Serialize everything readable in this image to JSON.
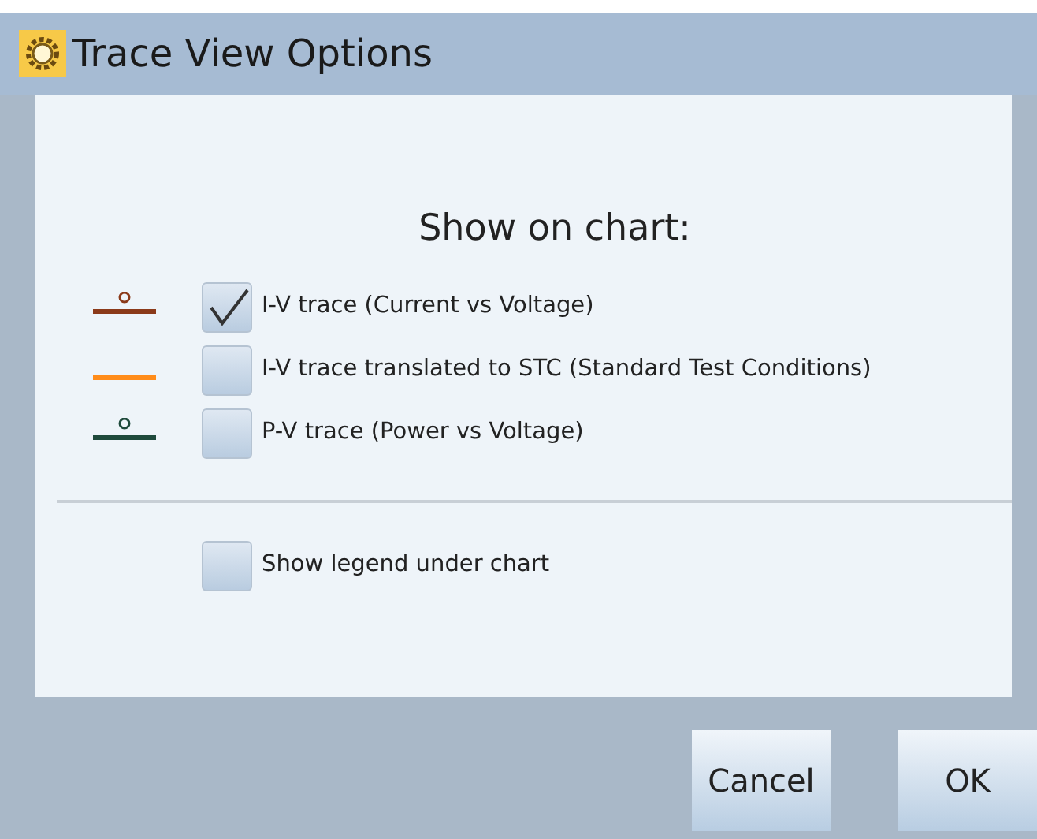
{
  "window": {
    "title": "Trace View Options"
  },
  "heading": "Show on chart:",
  "traces": [
    {
      "label": "I-V trace (Current vs Voltage)",
      "checked": true,
      "color": "#8b3a1a",
      "marker": true
    },
    {
      "label": "I-V trace translated to STC (Standard Test Conditions)",
      "checked": false,
      "color": "#ff8c1a",
      "marker": false
    },
    {
      "label": "P-V trace (Power vs Voltage)",
      "checked": false,
      "color": "#1f4a3c",
      "marker": true
    }
  ],
  "legend_option": {
    "label": "Show legend under chart",
    "checked": false
  },
  "buttons": [
    "Cancel",
    "OK"
  ]
}
